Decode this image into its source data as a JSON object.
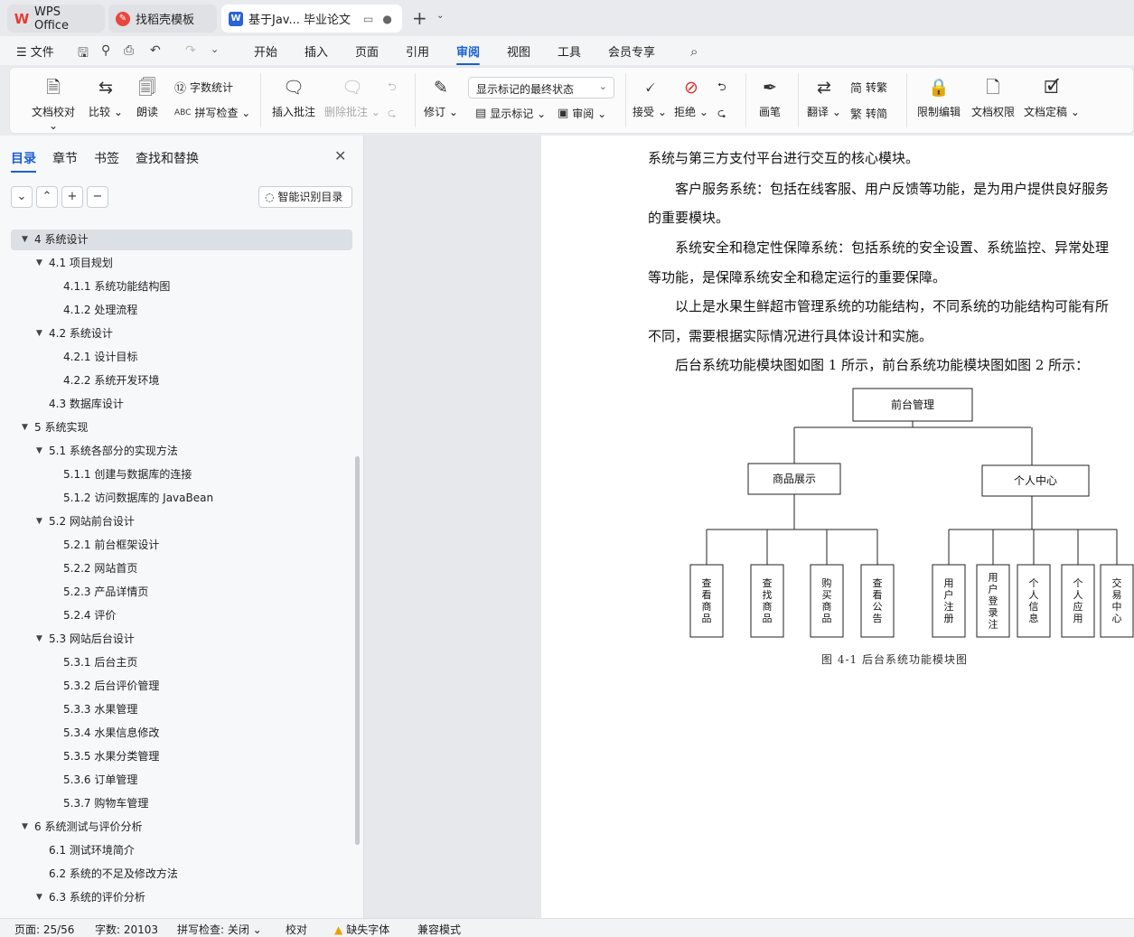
{
  "tabs": [
    {
      "label": "WPS Office",
      "icon": "wps-logo-icon"
    },
    {
      "label": "找稻壳模板",
      "icon": "docer-icon"
    },
    {
      "label": "基于Jav... 毕业论文",
      "icon": "word-doc-icon"
    }
  ],
  "menu": {
    "file": "文件",
    "items": [
      "开始",
      "插入",
      "页面",
      "引用",
      "审阅",
      "视图",
      "工具",
      "会员专享"
    ],
    "active": "审阅"
  },
  "ribbon": {
    "proofread": "文档校对",
    "compare": "比较",
    "read_aloud": "朗读",
    "word_count": "字数统计",
    "spell_check": "拼写检查",
    "insert_comment": "插入批注",
    "delete_comment": "删除批注",
    "track_changes": "修订",
    "mark_state": "显示标记的最终状态",
    "show_markup": "显示标记",
    "review": "审阅",
    "accept": "接受",
    "reject": "拒绝",
    "pen": "画笔",
    "translate": "翻译",
    "to_traditional": "转繁",
    "to_simplified": "转简",
    "restrict_edit": "限制编辑",
    "doc_permission": "文档权限",
    "finalize": "文档定稿"
  },
  "nav": {
    "tabs": [
      "目录",
      "章节",
      "书签",
      "查找和替换"
    ],
    "smart_toc": "智能识别目录",
    "items": [
      {
        "text": "4  系统设计",
        "level": 0,
        "selected": true
      },
      {
        "text": "4.1  项目规划",
        "level": 1
      },
      {
        "text": "4.1.1  系统功能结构图",
        "level": 2
      },
      {
        "text": "4.1.2  处理流程",
        "level": 2
      },
      {
        "text": "4.2  系统设计",
        "level": 1
      },
      {
        "text": "4.2.1  设计目标",
        "level": 2
      },
      {
        "text": "4.2.2  系统开发环境",
        "level": 2
      },
      {
        "text": "4.3  数据库设计",
        "level": 1,
        "leaf": true
      },
      {
        "text": "5  系统实现",
        "level": 0
      },
      {
        "text": "5.1  系统各部分的实现方法",
        "level": 1
      },
      {
        "text": "5.1.1  创建与数据库的连接",
        "level": 2
      },
      {
        "text": "5.1.2  访问数据库的 JavaBean",
        "level": 2
      },
      {
        "text": "5.2  网站前台设计",
        "level": 1
      },
      {
        "text": "5.2.1 前台框架设计",
        "level": 2
      },
      {
        "text": "5.2.2  网站首页",
        "level": 2
      },
      {
        "text": "5.2.3  产品详情页",
        "level": 2
      },
      {
        "text": "5.2.4  评价",
        "level": 2
      },
      {
        "text": "5.3 网站后台设计",
        "level": 1
      },
      {
        "text": "5.3.1  后台主页",
        "level": 2
      },
      {
        "text": "5.3.2  后台评价管理",
        "level": 2
      },
      {
        "text": "5.3.3  水果管理",
        "level": 2
      },
      {
        "text": "5.3.4  水果信息修改",
        "level": 2
      },
      {
        "text": "5.3.5  水果分类管理",
        "level": 2
      },
      {
        "text": "5.3.6  订单管理",
        "level": 2
      },
      {
        "text": "5.3.7  购物车管理",
        "level": 2
      },
      {
        "text": "6  系统测试与评价分析",
        "level": 0
      },
      {
        "text": "6.1  测试环境简介",
        "level": 1,
        "leaf": true
      },
      {
        "text": "6.2  系统的不足及修改方法",
        "level": 1,
        "leaf": true
      },
      {
        "text": "6.3  系统的评价分析",
        "level": 1
      }
    ]
  },
  "doc": {
    "paragraphs": [
      "系统与第三方支付平台进行交互的核心模块。",
      "　　客户服务系统：包括在线客服、用户反馈等功能，是为用户提供良好服务",
      "的重要模块。",
      "　　系统安全和稳定性保障系统：包括系统的安全设置、系统监控、异常处理",
      "等功能，是保障系统安全和稳定运行的重要保障。",
      "　　以上是水果生鲜超市管理系统的功能结构，不同系统的功能结构可能有所",
      "不同，需要根据实际情况进行具体设计和实施。",
      "　　后台系统功能模块图如图 1 所示，前台系统功能模块图如图 2 所示："
    ],
    "diagram": {
      "root": "前台管理",
      "branches": [
        {
          "label": "商品展示",
          "leaves": [
            "查看商品",
            "查找商品",
            "购买商品",
            "查看公告"
          ]
        },
        {
          "label": "个人中心",
          "leaves": [
            "用户注册",
            "用户登录注",
            "个人信息",
            "个人应用",
            "交易中心"
          ]
        }
      ]
    },
    "caption": "图 4-1 后台系统功能模块图"
  },
  "status": {
    "page": "页面: 25/56",
    "words": "字数: 20103",
    "spell": "拼写检查: 关闭",
    "proof": "校对",
    "missing_font": "缺失字体",
    "compat": "兼容模式"
  }
}
